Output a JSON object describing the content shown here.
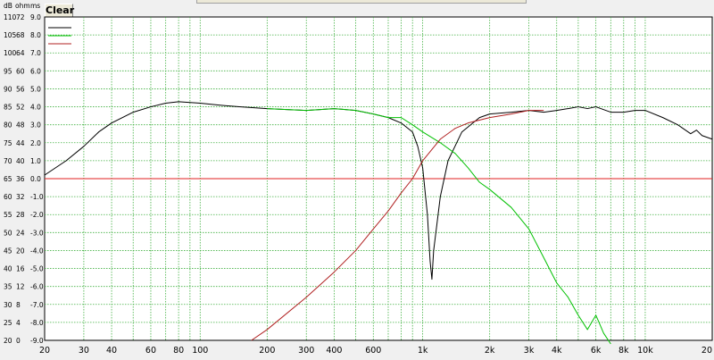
{
  "toolbar": {
    "clear_label": "Clear"
  },
  "axis_headers": {
    "db": "dB",
    "ohm": "ohm",
    "ms": "ms"
  },
  "chart_data": {
    "type": "line",
    "x_scale": "log",
    "xlim": [
      20,
      20000
    ],
    "x_ticks": [
      {
        "value": 20,
        "label": "20"
      },
      {
        "value": 30,
        "label": "30"
      },
      {
        "value": 40,
        "label": "40"
      },
      {
        "value": 60,
        "label": "60"
      },
      {
        "value": 80,
        "label": "80"
      },
      {
        "value": 100,
        "label": "100"
      },
      {
        "value": 200,
        "label": "200"
      },
      {
        "value": 300,
        "label": "300"
      },
      {
        "value": 400,
        "label": "400"
      },
      {
        "value": 600,
        "label": "600"
      },
      {
        "value": 1000,
        "label": "1k"
      },
      {
        "value": 2000,
        "label": "2k"
      },
      {
        "value": 3000,
        "label": "3k"
      },
      {
        "value": 4000,
        "label": "4k"
      },
      {
        "value": 6000,
        "label": "6k"
      },
      {
        "value": 8000,
        "label": "8k"
      },
      {
        "value": 10000,
        "label": "10k"
      },
      {
        "value": 20000,
        "label": "20"
      }
    ],
    "ylim": [
      20,
      110
    ],
    "y_ticks_db": [
      110,
      105,
      100,
      95,
      90,
      85,
      80,
      75,
      70,
      65,
      60,
      55,
      50,
      45,
      40,
      35,
      30,
      25,
      20
    ],
    "y_ticks_ohm": [
      72,
      68,
      64,
      60,
      56,
      52,
      48,
      44,
      40,
      36,
      32,
      28,
      24,
      20,
      16,
      12,
      8,
      4,
      0
    ],
    "y_ticks_ms": [
      "9.0",
      "8.0",
      "7.0",
      "6.0",
      "5.0",
      "4.0",
      "3.0",
      "2.0",
      "1.0",
      "0.0",
      "-1.0",
      "-2.0",
      "-3.0",
      "-4.0",
      "-5.0",
      "-6.0",
      "-7.0",
      "-8.0",
      "-9.0"
    ],
    "reference_line_db": 65,
    "grid": true,
    "legend_position": "top-left",
    "colors": {
      "background": "#ffffff",
      "grid": "#40b040",
      "reference": "#e02020",
      "frame": "#000000"
    },
    "series": [
      {
        "color": "#000000",
        "points": [
          [
            20,
            66
          ],
          [
            25,
            70
          ],
          [
            30,
            74
          ],
          [
            35,
            78
          ],
          [
            40,
            80.5
          ],
          [
            50,
            83.5
          ],
          [
            60,
            85
          ],
          [
            70,
            86
          ],
          [
            80,
            86.4
          ],
          [
            100,
            86
          ],
          [
            120,
            85.5
          ],
          [
            150,
            85
          ],
          [
            200,
            84.5
          ],
          [
            300,
            84
          ],
          [
            400,
            84.5
          ],
          [
            500,
            84
          ],
          [
            600,
            83
          ],
          [
            700,
            82
          ],
          [
            800,
            80.5
          ],
          [
            900,
            78
          ],
          [
            950,
            74
          ],
          [
            1000,
            68
          ],
          [
            1050,
            55
          ],
          [
            1080,
            42
          ],
          [
            1100,
            37
          ],
          [
            1120,
            45
          ],
          [
            1200,
            60
          ],
          [
            1300,
            70
          ],
          [
            1500,
            78
          ],
          [
            1800,
            82
          ],
          [
            2000,
            83
          ],
          [
            2500,
            83.5
          ],
          [
            3000,
            84
          ],
          [
            3500,
            83.5
          ],
          [
            4000,
            84
          ],
          [
            4500,
            84.5
          ],
          [
            5000,
            85
          ],
          [
            5500,
            84.5
          ],
          [
            6000,
            85
          ],
          [
            7000,
            83.5
          ],
          [
            8000,
            83.5
          ],
          [
            9000,
            84
          ],
          [
            10000,
            84
          ],
          [
            12000,
            82
          ],
          [
            14000,
            80
          ],
          [
            16000,
            77.5
          ],
          [
            17000,
            78.5
          ],
          [
            18000,
            77
          ],
          [
            20000,
            76
          ]
        ]
      },
      {
        "color": "#00c000",
        "points": [
          [
            200,
            84.5
          ],
          [
            300,
            84
          ],
          [
            400,
            84.5
          ],
          [
            500,
            84
          ],
          [
            600,
            83
          ],
          [
            700,
            82
          ],
          [
            800,
            82
          ],
          [
            900,
            80
          ],
          [
            1000,
            78
          ],
          [
            1200,
            75
          ],
          [
            1400,
            72
          ],
          [
            1600,
            68
          ],
          [
            1800,
            64
          ],
          [
            2000,
            62
          ],
          [
            2500,
            57
          ],
          [
            3000,
            51
          ],
          [
            3500,
            43
          ],
          [
            4000,
            36
          ],
          [
            4500,
            32
          ],
          [
            5000,
            27
          ],
          [
            5500,
            23
          ],
          [
            6000,
            27
          ],
          [
            6200,
            25
          ],
          [
            6500,
            22
          ],
          [
            7000,
            19
          ]
        ]
      },
      {
        "color": "#b02020",
        "points": [
          [
            170,
            20
          ],
          [
            200,
            23
          ],
          [
            300,
            32
          ],
          [
            400,
            39
          ],
          [
            500,
            45
          ],
          [
            600,
            51
          ],
          [
            700,
            56
          ],
          [
            800,
            61
          ],
          [
            900,
            65
          ],
          [
            1000,
            70
          ],
          [
            1200,
            76
          ],
          [
            1400,
            79
          ],
          [
            1600,
            80.5
          ],
          [
            2000,
            82
          ],
          [
            2500,
            83
          ],
          [
            3000,
            84
          ],
          [
            3500,
            84
          ]
        ]
      }
    ]
  }
}
